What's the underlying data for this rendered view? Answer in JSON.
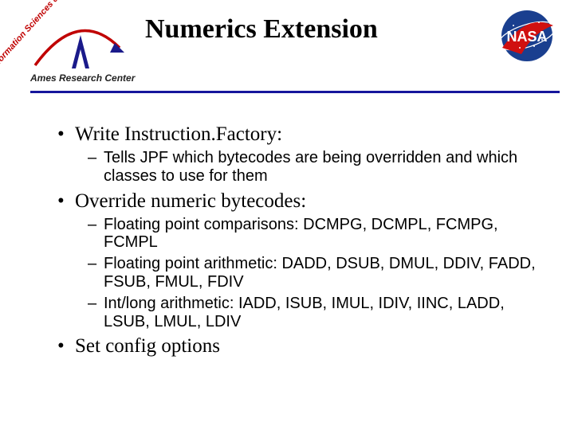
{
  "header": {
    "title": "Numerics Extension",
    "diag_text": "Information Sciences & Technology",
    "ames_label": "Ames Research Center",
    "nasa_label": "NASA"
  },
  "bullets": {
    "b1": {
      "text": "Write Instruction.Factory:",
      "sub": [
        "Tells JPF which bytecodes are being overridden and which classes to use for them"
      ]
    },
    "b2": {
      "text": "Override numeric bytecodes:",
      "sub": [
        "Floating point comparisons: DCMPG, DCMPL, FCMPG, FCMPL",
        "Floating point arithmetic: DADD, DSUB, DMUL, DDIV, FADD, FSUB, FMUL, FDIV",
        "Int/long arithmetic: IADD, ISUB, IMUL, IDIV, IINC, LADD, LSUB, LMUL, LDIV"
      ]
    },
    "b3": {
      "text": "Set config options",
      "sub": []
    }
  }
}
